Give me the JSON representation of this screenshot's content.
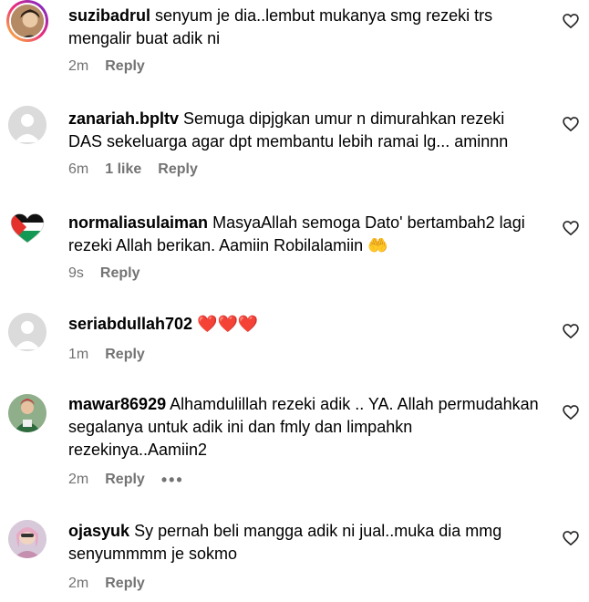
{
  "comments": [
    {
      "username": "suzibadrul",
      "text": "senyum je dia..lembut mukanya smg rezeki trs mengalir buat adik ni",
      "time": "2m",
      "reply": "Reply"
    },
    {
      "username": "zanariah.bpltv",
      "text": "Semuga dipjgkan umur n dimurahkan rezeki DAS sekeluarga agar dpt membantu lebih ramai lg... aminnn",
      "time": "6m",
      "likes": "1 like",
      "reply": "Reply"
    },
    {
      "username": "normaliasulaiman",
      "text": "MasyaAllah semoga Dato' bertambah2 lagi rezeki Allah berikan. Aamiin Robilalamiin",
      "emoji": "🤲",
      "time": "9s",
      "reply": "Reply"
    },
    {
      "username": "seriabdullah702",
      "emoji": "❤️❤️❤️",
      "time": "1m",
      "reply": "Reply"
    },
    {
      "username": "mawar86929",
      "text": "Alhamdulillah rezeki adik .. YA. Allah permudahkan segalanya untuk adik ini dan fmly dan limpahkn rezekinya..Aamiin2",
      "time": "2m",
      "reply": "Reply",
      "more": "•••"
    },
    {
      "username": "ojasyuk",
      "text": "Sy pernah beli mangga adik ni jual..muka dia mmg senyummmm je sokmo",
      "time": "2m",
      "reply": "Reply"
    }
  ],
  "icons": {
    "like": "heart-outline-icon",
    "default_avatar": "default-avatar-icon",
    "flag_avatar": "palestine-flag-heart"
  },
  "colors": {
    "meta_text": "#737373",
    "avatar_default": "#dbdbdb"
  }
}
